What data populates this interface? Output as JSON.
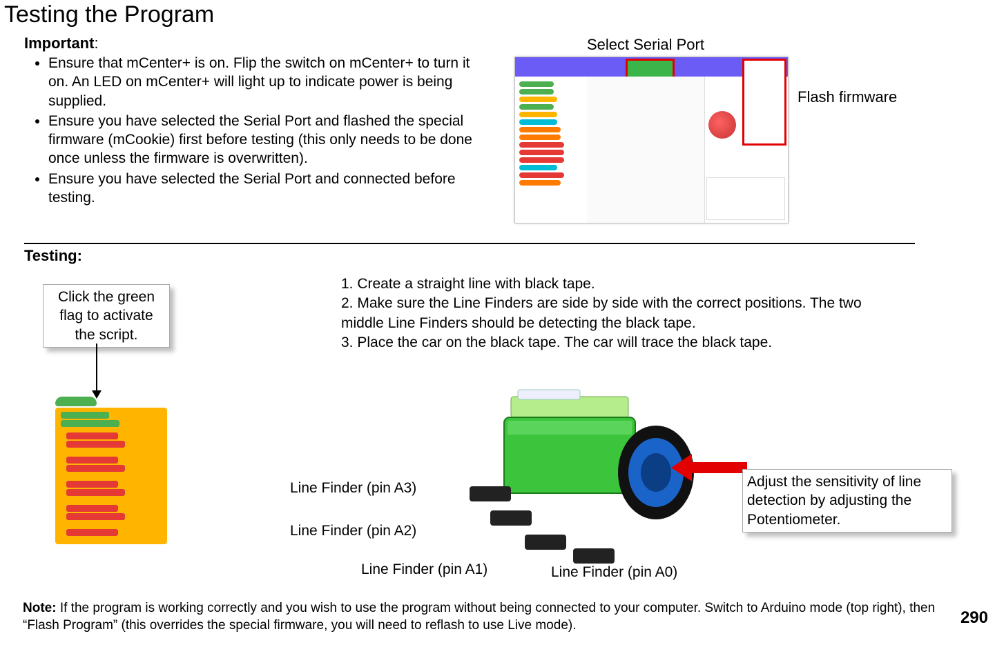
{
  "title": "Testing the Program",
  "important": {
    "heading": "Important",
    "colon": ":",
    "items": [
      "Ensure that mCenter+ is on. Flip the switch on mCenter+ to turn it on. An LED on mCenter+ will light up to indicate power is being supplied.",
      "Ensure you have selected the Serial Port and flashed the special firmware (mCookie) first before testing (this only needs to be done once unless the firmware is overwritten).",
      "Ensure you have selected the Serial Port and connected before testing."
    ]
  },
  "labels": {
    "select_serial": "Select Serial Port",
    "flash_firmware": "Flash firmware"
  },
  "testing": {
    "heading": "Testing:",
    "green_flag": "Click the green flag to activate the script.",
    "steps_html": "1. Create a straight line with black tape.\n2. Make sure the Line Finders are side by side with the correct positions. The two middle Line Finders should be detecting the black tape.\n3. Place the car on the black tape. The car will trace the black tape.",
    "potentiometer": "Adjust the sensitivity of line detection by adjusting the Potentiometer."
  },
  "line_finders": {
    "a3": "Line Finder (pin A3)",
    "a2": "Line Finder (pin A2)",
    "a1": "Line Finder (pin A1)",
    "a0": "Line Finder (pin A0)"
  },
  "note": {
    "bold": "Note: ",
    "text": "If the program is working correctly and you wish to use the program without being connected to your computer. Switch to Arduino mode (top right), then “Flash Program” (this overrides the special firmware, you will need to reflash to use Live mode)."
  },
  "page_number": "290"
}
